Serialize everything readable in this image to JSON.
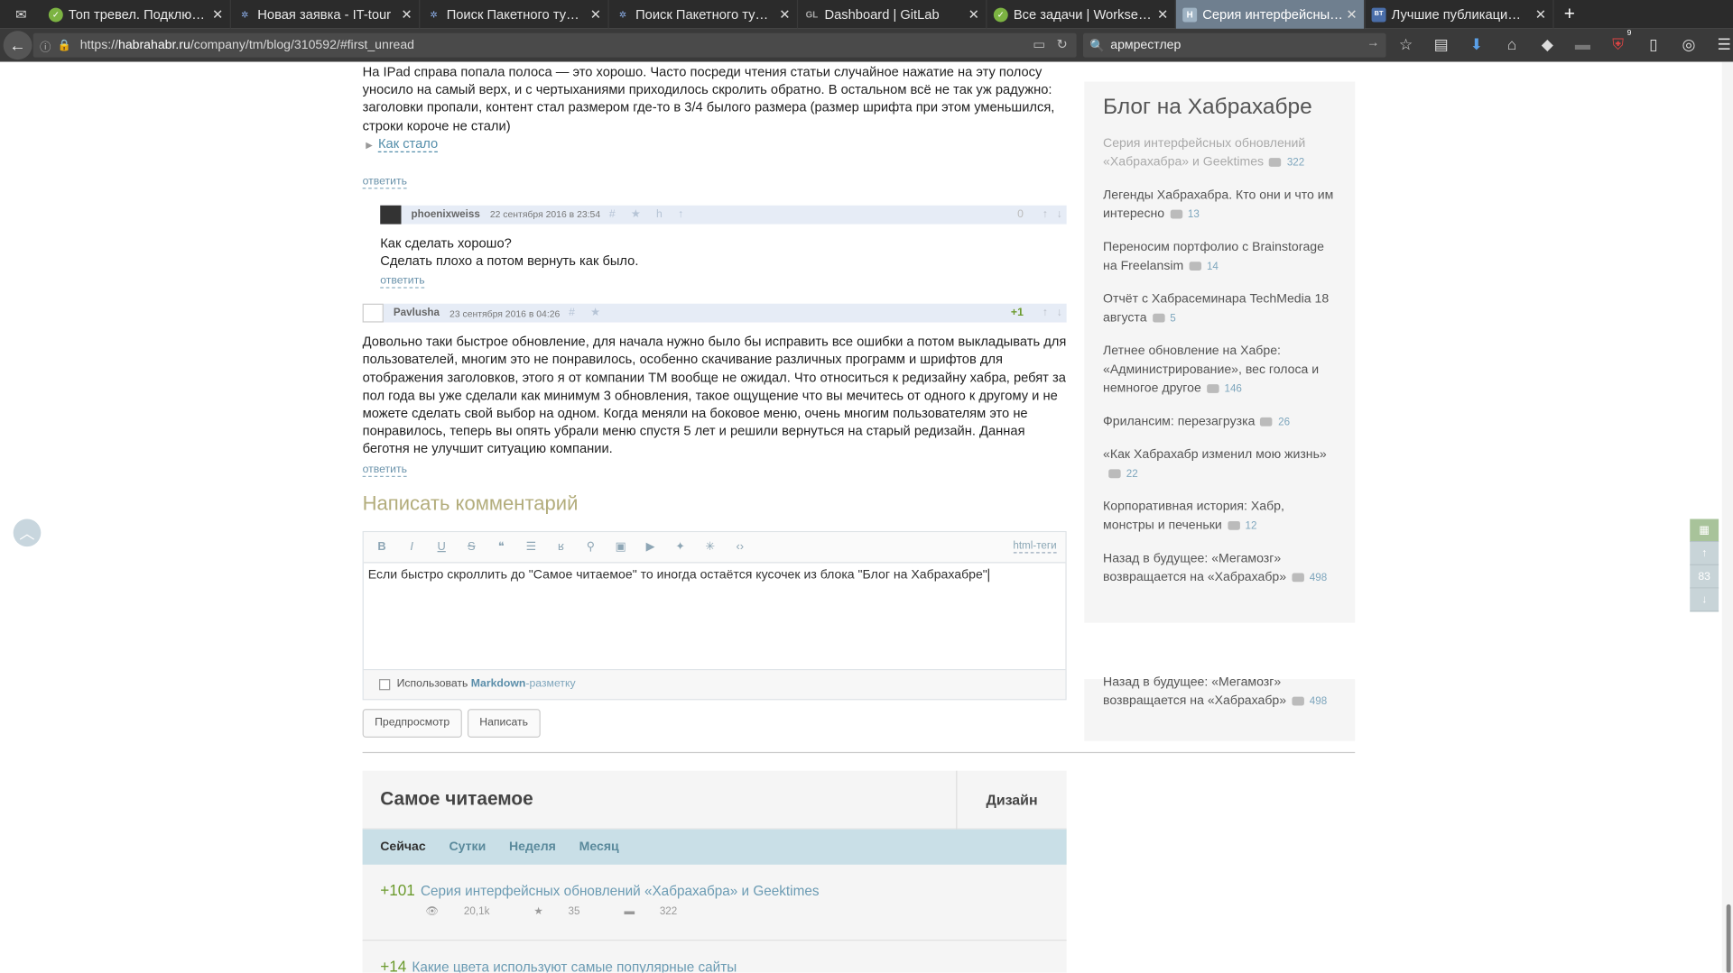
{
  "browser": {
    "tabs": [
      {
        "label": "Топ тревел. Подклю…",
        "icon_color": "#7cb342"
      },
      {
        "label": "Новая заявка - IT-tour",
        "icon_color": "#4f7ed0"
      },
      {
        "label": "Поиск Пакетного ту…",
        "icon_color": "#4f7ed0"
      },
      {
        "label": "Поиск Пакетного ту…",
        "icon_color": "#4f7ed0"
      },
      {
        "label": "Dashboard | GitLab",
        "icon_color": "#e2432a",
        "icon_text": "GL"
      },
      {
        "label": "Все задачи | Workse…",
        "icon_color": "#7cb342"
      },
      {
        "label": "Серия интерфейсны…",
        "icon_color": "#6c8aa2",
        "icon_text": "H",
        "active": true
      },
      {
        "label": "Лучшие публикаци…",
        "icon_color": "#4a6ea9",
        "icon_text": "BT"
      }
    ],
    "url_prefix": "https://",
    "url_domain": "habrahabr.ru",
    "url_path": "/company/tm/blog/310592/#first_unread",
    "search_value": "армрестлер",
    "badge_count": "9"
  },
  "article": {
    "text": "На IPad справа попала полоса — это хорошо. Часто посреди чтения статьи случайное нажатие на эту полосу уносило на самый верх, и с чертыханиями приходилось скролить обратно. В остальном всё не так уж радужно: заголовки пропали, контент стал размером где-то в 3/4 былого размера (размер шрифта при этом уменьшился, строки короче не стали)",
    "spoiler": "Как стало",
    "reply": "ответить"
  },
  "comments": [
    {
      "author": "phoenixweiss",
      "date": "22 сентября 2016 в 23:54",
      "score": "0",
      "lines": [
        "Как сделать хорошо?",
        "Сделать плохо а потом вернуть как было."
      ],
      "reply": "ответить"
    },
    {
      "author": "Pavlusha",
      "date": "23 сентября 2016 в 04:26",
      "score": "+1",
      "text": "Довольно таки быстрое обновление, для начала нужно было бы исправить все ошибки а потом выкладывать для пользователей, многим это не понравилось, особенно скачивание различных программ и шрифтов для отображения заголовков, этого я от компании TM вообще не ожидал. Что относиться к редизайну хабра, ребят за пол года вы уже сделали как минимум 3 обновления, такое ощущение что вы мечитесь от одного к другому и не можете сделать свой выбор на одном. Когда меняли на боковое меню, очень многим пользователям это не понравилось, теперь вы опять убрали меню спустя 5 лет и решили вернуться на старый редизайн. Данная беготня не улучшит ситуацию компании.",
      "reply": "ответить"
    }
  ],
  "form": {
    "title": "Написать комментарий",
    "html_tags": "html-теги",
    "text": "Если быстро скроллить до \"Самое читаемое\" то иногда остаётся кусочек из блока \"Блог на Хабрахабре\"",
    "markdown_prefix": "Использовать",
    "markdown_link": "Markdown",
    "markdown_suffix": "-разметку",
    "preview_label": "Предпросмотр",
    "submit_label": "Написать"
  },
  "most_read": {
    "title": "Самое читаемое",
    "category": "Дизайн",
    "tabs": [
      "Сейчас",
      "Сутки",
      "Неделя",
      "Месяц"
    ],
    "items": [
      {
        "score": "+101",
        "title": "Серия интерфейсных обновлений «Хабрахабра» и Geektimes",
        "views": "20,1k",
        "favs": "35",
        "comments": "322"
      },
      {
        "score": "+14",
        "title": "Какие цвета используют самые популярные сайты",
        "views": "",
        "favs": "",
        "comments": ""
      }
    ]
  },
  "sidebar": {
    "title": "Блог на Хабрахабре",
    "items": [
      {
        "title": "Серия интерфейсных обновлений «Хабрахабра» и Geektimes",
        "count": "322",
        "visited": true
      },
      {
        "title": "Легенды Хабрахабра. Кто они и что им интересно",
        "count": "13"
      },
      {
        "title": "Переносим портфолио с Brainstorage на Freelansim",
        "count": "14"
      },
      {
        "title": "Отчёт с Хабрасеминара TechMedia 18 августа",
        "count": "5"
      },
      {
        "title": "Летнее обновление на Хабре: «Администрирование», вес голоса и немногое другое",
        "count": "146"
      },
      {
        "title": "Фрилансим: перезагрузка",
        "count": "26"
      },
      {
        "title": "«Как Хабрахабр изменил мою жизнь»",
        "count": "22"
      },
      {
        "title": "Корпоративная история: Хабр, монстры и печеньки",
        "count": "12"
      },
      {
        "title": "Назад в будущее: «Мегамозг» возвращается на «Хабрахабр»",
        "count": "498"
      }
    ],
    "leftover_item": {
      "title": "Назад в будущее: «Мегамозг» возвращается на «Хабрахабр»",
      "count": "498"
    }
  },
  "right_widget": {
    "count": "83"
  }
}
